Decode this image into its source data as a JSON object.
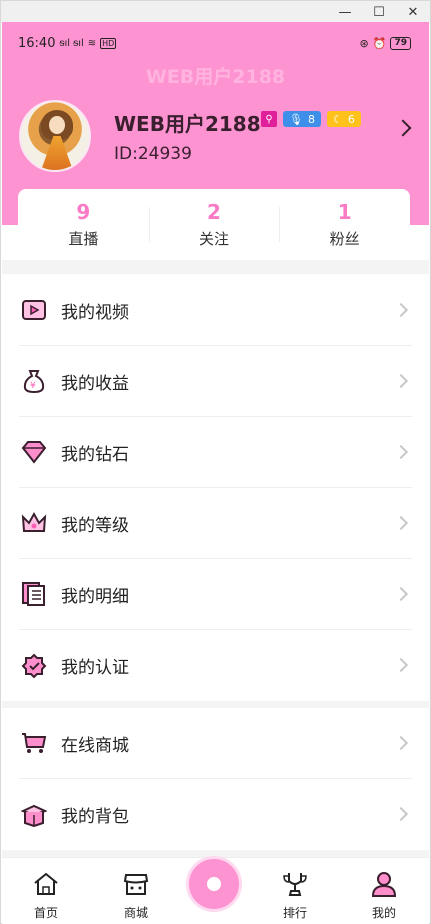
{
  "window": {
    "minimize": "—",
    "maximize": "☐",
    "close": "✕"
  },
  "status": {
    "time": "16:40",
    "signal": "ᵴıl ᵴıl",
    "wifi": "≋",
    "hd": "HD",
    "battery": "79"
  },
  "header": {
    "ghost_title": "WEB用户2188",
    "username": "WEB用户2188",
    "badge_mic": "8",
    "badge_moon": "6",
    "user_id": "ID:24939"
  },
  "stats": [
    {
      "value": "9",
      "label": "直播"
    },
    {
      "value": "2",
      "label": "关注"
    },
    {
      "value": "1",
      "label": "粉丝"
    }
  ],
  "menu": [
    {
      "label": "我的视频",
      "icon": "video-icon"
    },
    {
      "label": "我的收益",
      "icon": "money-bag-icon"
    },
    {
      "label": "我的钻石",
      "icon": "diamond-icon"
    },
    {
      "label": "我的等级",
      "icon": "crown-icon"
    },
    {
      "label": "我的明细",
      "icon": "list-icon"
    },
    {
      "label": "我的认证",
      "icon": "verified-icon"
    }
  ],
  "menu2": [
    {
      "label": "在线商城",
      "icon": "cart-icon"
    },
    {
      "label": "我的背包",
      "icon": "gift-box-icon"
    }
  ],
  "tabs": [
    {
      "label": "首页",
      "icon": "home-icon"
    },
    {
      "label": "商城",
      "icon": "shop-icon"
    },
    {
      "label": "排行",
      "icon": "trophy-icon"
    },
    {
      "label": "我的",
      "icon": "profile-icon"
    }
  ],
  "colors": {
    "accent": "#fe93d1",
    "stat_number": "#fb7ac6",
    "badge_blue": "#3d8fe9",
    "badge_yellow": "#ffc21a",
    "badge_magenta": "#e0209b"
  }
}
